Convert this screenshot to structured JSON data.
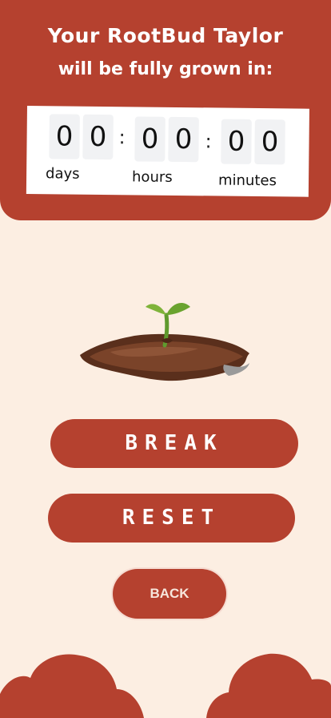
{
  "header": {
    "title_line_1": "Your RootBud Taylor",
    "title_line_2": "will be fully grown in:"
  },
  "timer": {
    "days": [
      "0",
      "0"
    ],
    "hours": [
      "0",
      "0"
    ],
    "minutes": [
      "0",
      "0"
    ],
    "separator": ":",
    "labels": {
      "days": "days",
      "hours": "hours",
      "minutes": "minutes"
    }
  },
  "buttons": {
    "break_label": "BREAK",
    "reset_label": "RESET",
    "back_label": "BACK"
  },
  "colors": {
    "accent": "#b5412f",
    "background": "#fceee2"
  },
  "icons": {
    "plant": "seedling-in-soil-icon",
    "decoration": "cloud-icon"
  }
}
